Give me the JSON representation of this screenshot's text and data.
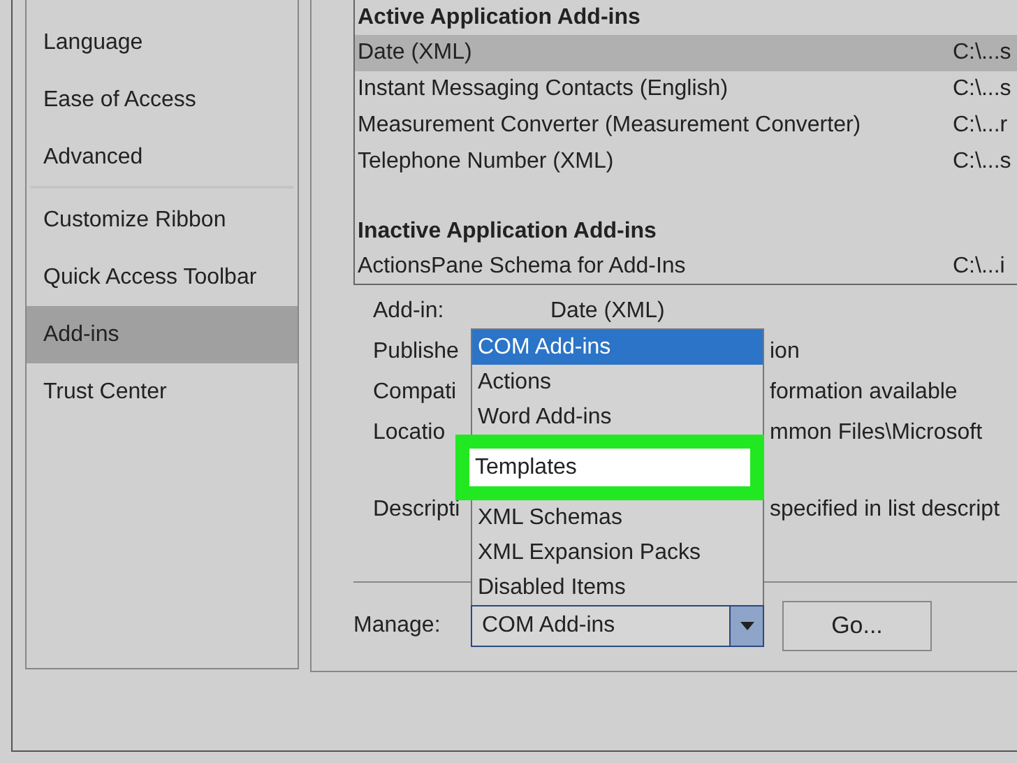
{
  "sidebar": {
    "items": [
      {
        "label": "Language",
        "selected": false
      },
      {
        "label": "Ease of Access",
        "selected": false
      },
      {
        "label": "Advanced",
        "selected": false,
        "divider_after": true
      },
      {
        "label": "Customize Ribbon",
        "selected": false
      },
      {
        "label": "Quick Access Toolbar",
        "selected": false
      },
      {
        "label": "Add-ins",
        "selected": true
      },
      {
        "label": "Trust Center",
        "selected": false
      }
    ]
  },
  "addins_table": {
    "groups": [
      {
        "heading": "Active Application Add-ins",
        "rows": [
          {
            "name": "Date (XML)",
            "location": "C:\\...s",
            "selected": true
          },
          {
            "name": "Instant Messaging Contacts (English)",
            "location": "C:\\...s",
            "selected": false
          },
          {
            "name": "Measurement Converter (Measurement Converter)",
            "location": "C:\\...r",
            "selected": false
          },
          {
            "name": "Telephone Number (XML)",
            "location": "C:\\...s",
            "selected": false
          }
        ]
      },
      {
        "heading": "Inactive Application Add-ins",
        "rows": [
          {
            "name": "ActionsPane Schema for Add-Ins",
            "location": "C:\\...i",
            "selected": false
          }
        ]
      }
    ]
  },
  "details": [
    {
      "label": "Add-in:",
      "value": "Date (XML)",
      "kind": "full"
    },
    {
      "label": "Publishe",
      "value": "ion",
      "kind": "covered"
    },
    {
      "label": "Compati",
      "value": "formation available",
      "kind": "covered"
    },
    {
      "label": "Locatio",
      "value": "mmon Files\\Microsoft",
      "kind": "covered"
    },
    {
      "label": "Descripti",
      "value": "specified in list descript",
      "kind": "covered",
      "gap_before": true
    }
  ],
  "manage": {
    "label": "Manage:",
    "value": "COM Add-ins",
    "button": "Go...",
    "expanded": true,
    "options": [
      {
        "label": "COM Add-ins",
        "selected": true,
        "highlighted": false
      },
      {
        "label": "Actions",
        "selected": false,
        "highlighted": false
      },
      {
        "label": "Word Add-ins",
        "selected": false,
        "highlighted": false
      },
      {
        "label": "Templates",
        "selected": false,
        "highlighted": true
      },
      {
        "label": "XML Schemas",
        "selected": false,
        "highlighted": false
      },
      {
        "label": "XML Expansion Packs",
        "selected": false,
        "highlighted": false
      },
      {
        "label": "Disabled Items",
        "selected": false,
        "highlighted": false
      }
    ]
  }
}
